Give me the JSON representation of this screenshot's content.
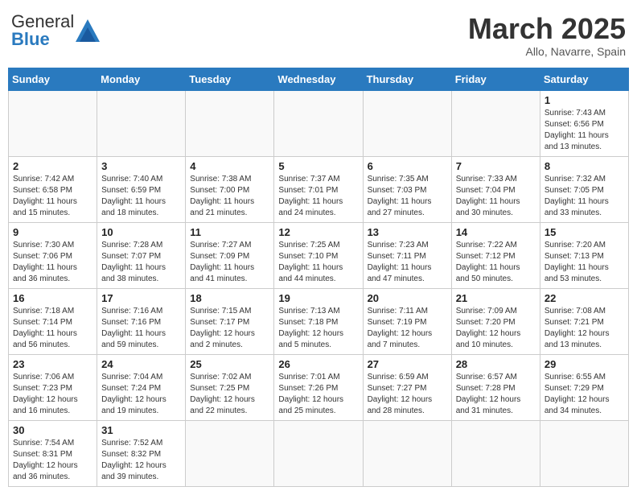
{
  "header": {
    "logo_text_general": "General",
    "logo_text_blue": "Blue",
    "month_title": "March 2025",
    "subtitle": "Allo, Navarre, Spain"
  },
  "days_of_week": [
    "Sunday",
    "Monday",
    "Tuesday",
    "Wednesday",
    "Thursday",
    "Friday",
    "Saturday"
  ],
  "weeks": [
    [
      {
        "day": "",
        "info": ""
      },
      {
        "day": "",
        "info": ""
      },
      {
        "day": "",
        "info": ""
      },
      {
        "day": "",
        "info": ""
      },
      {
        "day": "",
        "info": ""
      },
      {
        "day": "",
        "info": ""
      },
      {
        "day": "1",
        "info": "Sunrise: 7:43 AM\nSunset: 6:56 PM\nDaylight: 11 hours and 13 minutes."
      }
    ],
    [
      {
        "day": "2",
        "info": "Sunrise: 7:42 AM\nSunset: 6:58 PM\nDaylight: 11 hours and 15 minutes."
      },
      {
        "day": "3",
        "info": "Sunrise: 7:40 AM\nSunset: 6:59 PM\nDaylight: 11 hours and 18 minutes."
      },
      {
        "day": "4",
        "info": "Sunrise: 7:38 AM\nSunset: 7:00 PM\nDaylight: 11 hours and 21 minutes."
      },
      {
        "day": "5",
        "info": "Sunrise: 7:37 AM\nSunset: 7:01 PM\nDaylight: 11 hours and 24 minutes."
      },
      {
        "day": "6",
        "info": "Sunrise: 7:35 AM\nSunset: 7:03 PM\nDaylight: 11 hours and 27 minutes."
      },
      {
        "day": "7",
        "info": "Sunrise: 7:33 AM\nSunset: 7:04 PM\nDaylight: 11 hours and 30 minutes."
      },
      {
        "day": "8",
        "info": "Sunrise: 7:32 AM\nSunset: 7:05 PM\nDaylight: 11 hours and 33 minutes."
      }
    ],
    [
      {
        "day": "9",
        "info": "Sunrise: 7:30 AM\nSunset: 7:06 PM\nDaylight: 11 hours and 36 minutes."
      },
      {
        "day": "10",
        "info": "Sunrise: 7:28 AM\nSunset: 7:07 PM\nDaylight: 11 hours and 38 minutes."
      },
      {
        "day": "11",
        "info": "Sunrise: 7:27 AM\nSunset: 7:09 PM\nDaylight: 11 hours and 41 minutes."
      },
      {
        "day": "12",
        "info": "Sunrise: 7:25 AM\nSunset: 7:10 PM\nDaylight: 11 hours and 44 minutes."
      },
      {
        "day": "13",
        "info": "Sunrise: 7:23 AM\nSunset: 7:11 PM\nDaylight: 11 hours and 47 minutes."
      },
      {
        "day": "14",
        "info": "Sunrise: 7:22 AM\nSunset: 7:12 PM\nDaylight: 11 hours and 50 minutes."
      },
      {
        "day": "15",
        "info": "Sunrise: 7:20 AM\nSunset: 7:13 PM\nDaylight: 11 hours and 53 minutes."
      }
    ],
    [
      {
        "day": "16",
        "info": "Sunrise: 7:18 AM\nSunset: 7:14 PM\nDaylight: 11 hours and 56 minutes."
      },
      {
        "day": "17",
        "info": "Sunrise: 7:16 AM\nSunset: 7:16 PM\nDaylight: 11 hours and 59 minutes."
      },
      {
        "day": "18",
        "info": "Sunrise: 7:15 AM\nSunset: 7:17 PM\nDaylight: 12 hours and 2 minutes."
      },
      {
        "day": "19",
        "info": "Sunrise: 7:13 AM\nSunset: 7:18 PM\nDaylight: 12 hours and 5 minutes."
      },
      {
        "day": "20",
        "info": "Sunrise: 7:11 AM\nSunset: 7:19 PM\nDaylight: 12 hours and 7 minutes."
      },
      {
        "day": "21",
        "info": "Sunrise: 7:09 AM\nSunset: 7:20 PM\nDaylight: 12 hours and 10 minutes."
      },
      {
        "day": "22",
        "info": "Sunrise: 7:08 AM\nSunset: 7:21 PM\nDaylight: 12 hours and 13 minutes."
      }
    ],
    [
      {
        "day": "23",
        "info": "Sunrise: 7:06 AM\nSunset: 7:23 PM\nDaylight: 12 hours and 16 minutes."
      },
      {
        "day": "24",
        "info": "Sunrise: 7:04 AM\nSunset: 7:24 PM\nDaylight: 12 hours and 19 minutes."
      },
      {
        "day": "25",
        "info": "Sunrise: 7:02 AM\nSunset: 7:25 PM\nDaylight: 12 hours and 22 minutes."
      },
      {
        "day": "26",
        "info": "Sunrise: 7:01 AM\nSunset: 7:26 PM\nDaylight: 12 hours and 25 minutes."
      },
      {
        "day": "27",
        "info": "Sunrise: 6:59 AM\nSunset: 7:27 PM\nDaylight: 12 hours and 28 minutes."
      },
      {
        "day": "28",
        "info": "Sunrise: 6:57 AM\nSunset: 7:28 PM\nDaylight: 12 hours and 31 minutes."
      },
      {
        "day": "29",
        "info": "Sunrise: 6:55 AM\nSunset: 7:29 PM\nDaylight: 12 hours and 34 minutes."
      }
    ],
    [
      {
        "day": "30",
        "info": "Sunrise: 7:54 AM\nSunset: 8:31 PM\nDaylight: 12 hours and 36 minutes."
      },
      {
        "day": "31",
        "info": "Sunrise: 7:52 AM\nSunset: 8:32 PM\nDaylight: 12 hours and 39 minutes."
      },
      {
        "day": "",
        "info": ""
      },
      {
        "day": "",
        "info": ""
      },
      {
        "day": "",
        "info": ""
      },
      {
        "day": "",
        "info": ""
      },
      {
        "day": "",
        "info": ""
      }
    ]
  ]
}
